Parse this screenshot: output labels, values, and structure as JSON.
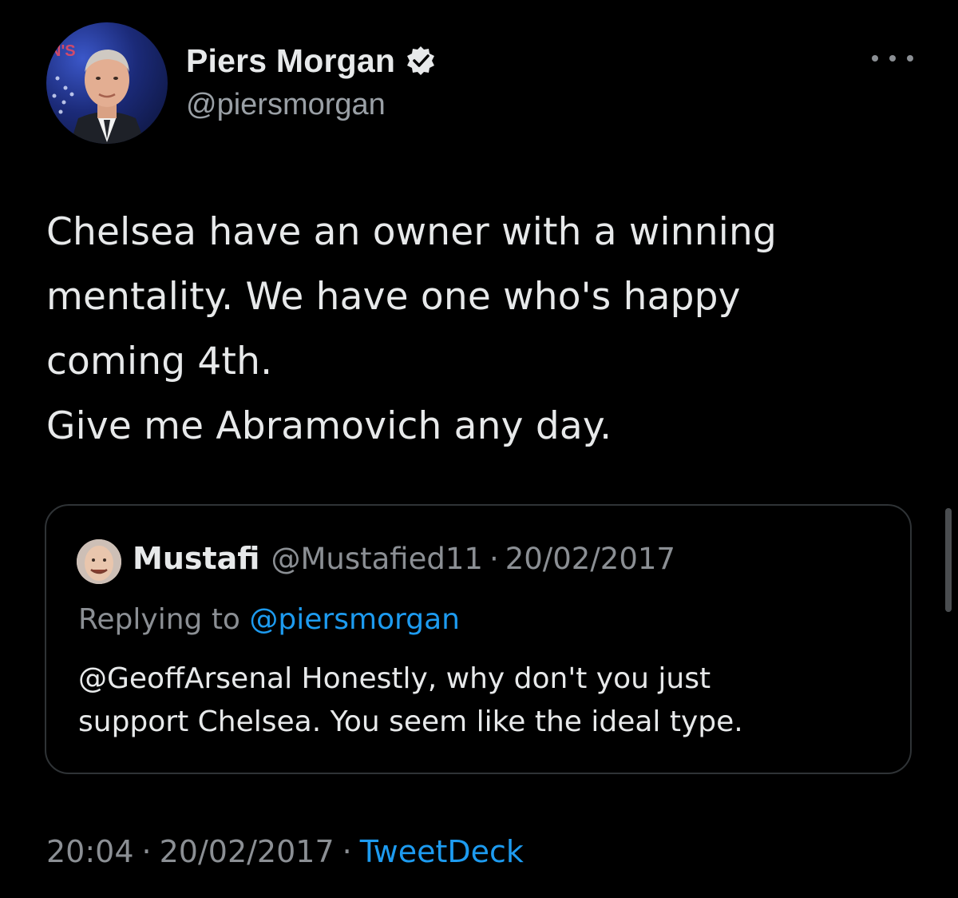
{
  "author": {
    "display_name": "Piers Morgan",
    "handle": "@piersmorgan",
    "verified": true,
    "avatar_icon": "profile-photo"
  },
  "more_icon": "more-horizontal-icon",
  "tweet": {
    "text": "Chelsea have an owner with a winning\nmentality. We have one who's happy\ncoming 4th.\nGive me Abramovich any day."
  },
  "quoted_tweet": {
    "display_name": "Mustafi",
    "handle": "@Mustafied11",
    "separator": "·",
    "date": "20/02/2017",
    "replying_prefix": "Replying to ",
    "replying_to": "@piersmorgan",
    "text": "@GeoffArsenal Honestly, why don't you just\nsupport Chelsea. You seem like the ideal type."
  },
  "footer": {
    "time": "20:04",
    "separator": "·",
    "date": "20/02/2017",
    "source": "TweetDeck"
  },
  "colors": {
    "background": "#000000",
    "text": "#e7e9ea",
    "muted": "#8b8f94",
    "link": "#1d9bf0",
    "border": "#2f3336"
  }
}
